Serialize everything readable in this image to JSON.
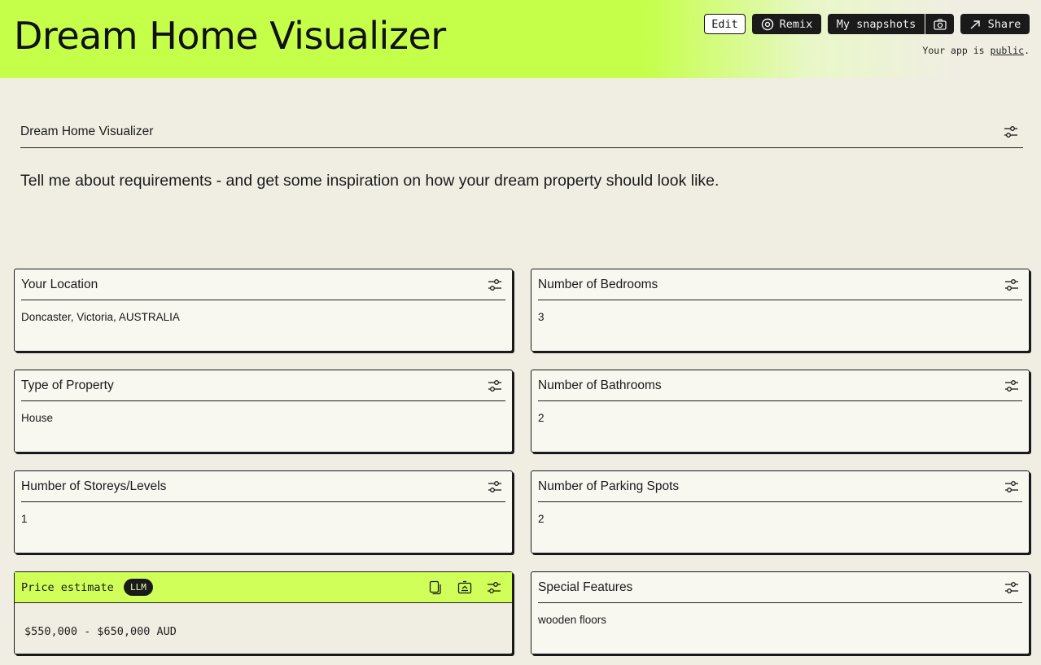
{
  "header": {
    "title": "Dream Home Visualizer",
    "buttons": {
      "edit": "Edit",
      "remix": "Remix",
      "snapshots": "My snapshots",
      "share": "Share"
    },
    "public_prefix": "Your app is",
    "public_link": "public",
    "public_suffix": "."
  },
  "section": {
    "title": "Dream Home Visualizer",
    "intro": "Tell me about requirements - and get some inspiration on how your dream property should look like."
  },
  "cards": {
    "location": {
      "label": "Your Location",
      "value": "Doncaster, Victoria, AUSTRALIA"
    },
    "bedrooms": {
      "label": "Number of Bedrooms",
      "value": "3"
    },
    "property_type": {
      "label": "Type of Property",
      "value": "House"
    },
    "bathrooms": {
      "label": "Number of Bathrooms",
      "value": "2"
    },
    "storeys": {
      "label": "Humber of Storeys/Levels",
      "value": "1"
    },
    "parking": {
      "label": "Number of Parking Spots",
      "value": "2"
    },
    "price": {
      "label": "Price estimate",
      "badge": "LLM",
      "value": "$550,000 - $650,000 AUD"
    },
    "features": {
      "label": "Special Features",
      "value": "wooden floors"
    }
  },
  "icons": {
    "tune": "sliders-icon",
    "copy": "copy-icon",
    "regenerate": "regenerate-icon",
    "remix": "remix-icon",
    "camera": "camera-icon",
    "share": "share-arrow-icon"
  },
  "colors": {
    "accent": "#c5ff4a",
    "background": "#f0eee3",
    "card": "#f8f7f0",
    "dark": "#1a1a1a"
  }
}
